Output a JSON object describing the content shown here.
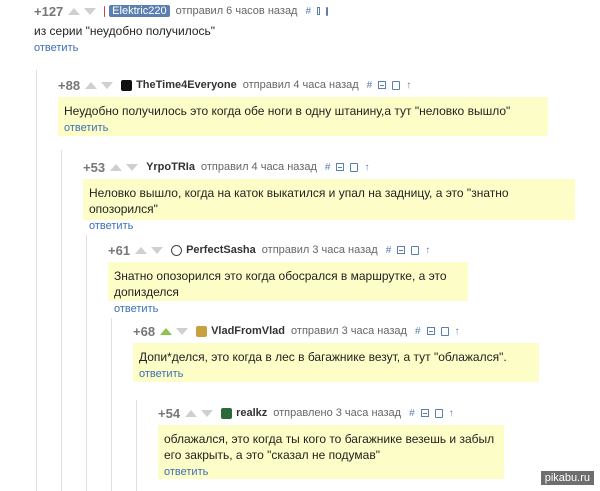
{
  "reply_label": "ответить",
  "colors": {
    "accent": "#5a7fb0",
    "highlight_bg": "#fdfdc8",
    "vote_active": "#8dc44a"
  },
  "comments": [
    {
      "rating": "+127",
      "user": "Elektric220",
      "meta": "отправил 6 часов назад",
      "text": "из серии \"неудобно получилось\""
    },
    {
      "rating": "+88",
      "user": "TheTime4Everyone",
      "meta": "отправил 4 часа назад",
      "text": "Неудобно получилось это когда обе ноги в одну штанину,а тут \"неловко вышло\""
    },
    {
      "rating": "+53",
      "user": "YrpoTRIa",
      "meta": "отправил 4 часа назад",
      "text": "Неловко вышло, когда на каток выкатился и упал на задницу, а это \"знатно опозорился\""
    },
    {
      "rating": "+61",
      "user": "PerfectSasha",
      "meta": "отправил 3 часа назад",
      "text": "Знатно опозорился это когда обосрался в маршрутке, а это допизделся"
    },
    {
      "rating": "+68",
      "user": "VladFromVlad",
      "meta": "отправил 3 часа назад",
      "text": "Допи*делся, это когда в лес в багажнике везут, а тут \"облажался\"."
    },
    {
      "rating": "+54",
      "user": "realkz",
      "meta": "отправлено 3 часа назад",
      "text": "облажался, это когда ты кого то багажнике везешь и забыл его закрыть, а это \"сказал не подумав\""
    }
  ],
  "watermark": "pikabu.ru"
}
